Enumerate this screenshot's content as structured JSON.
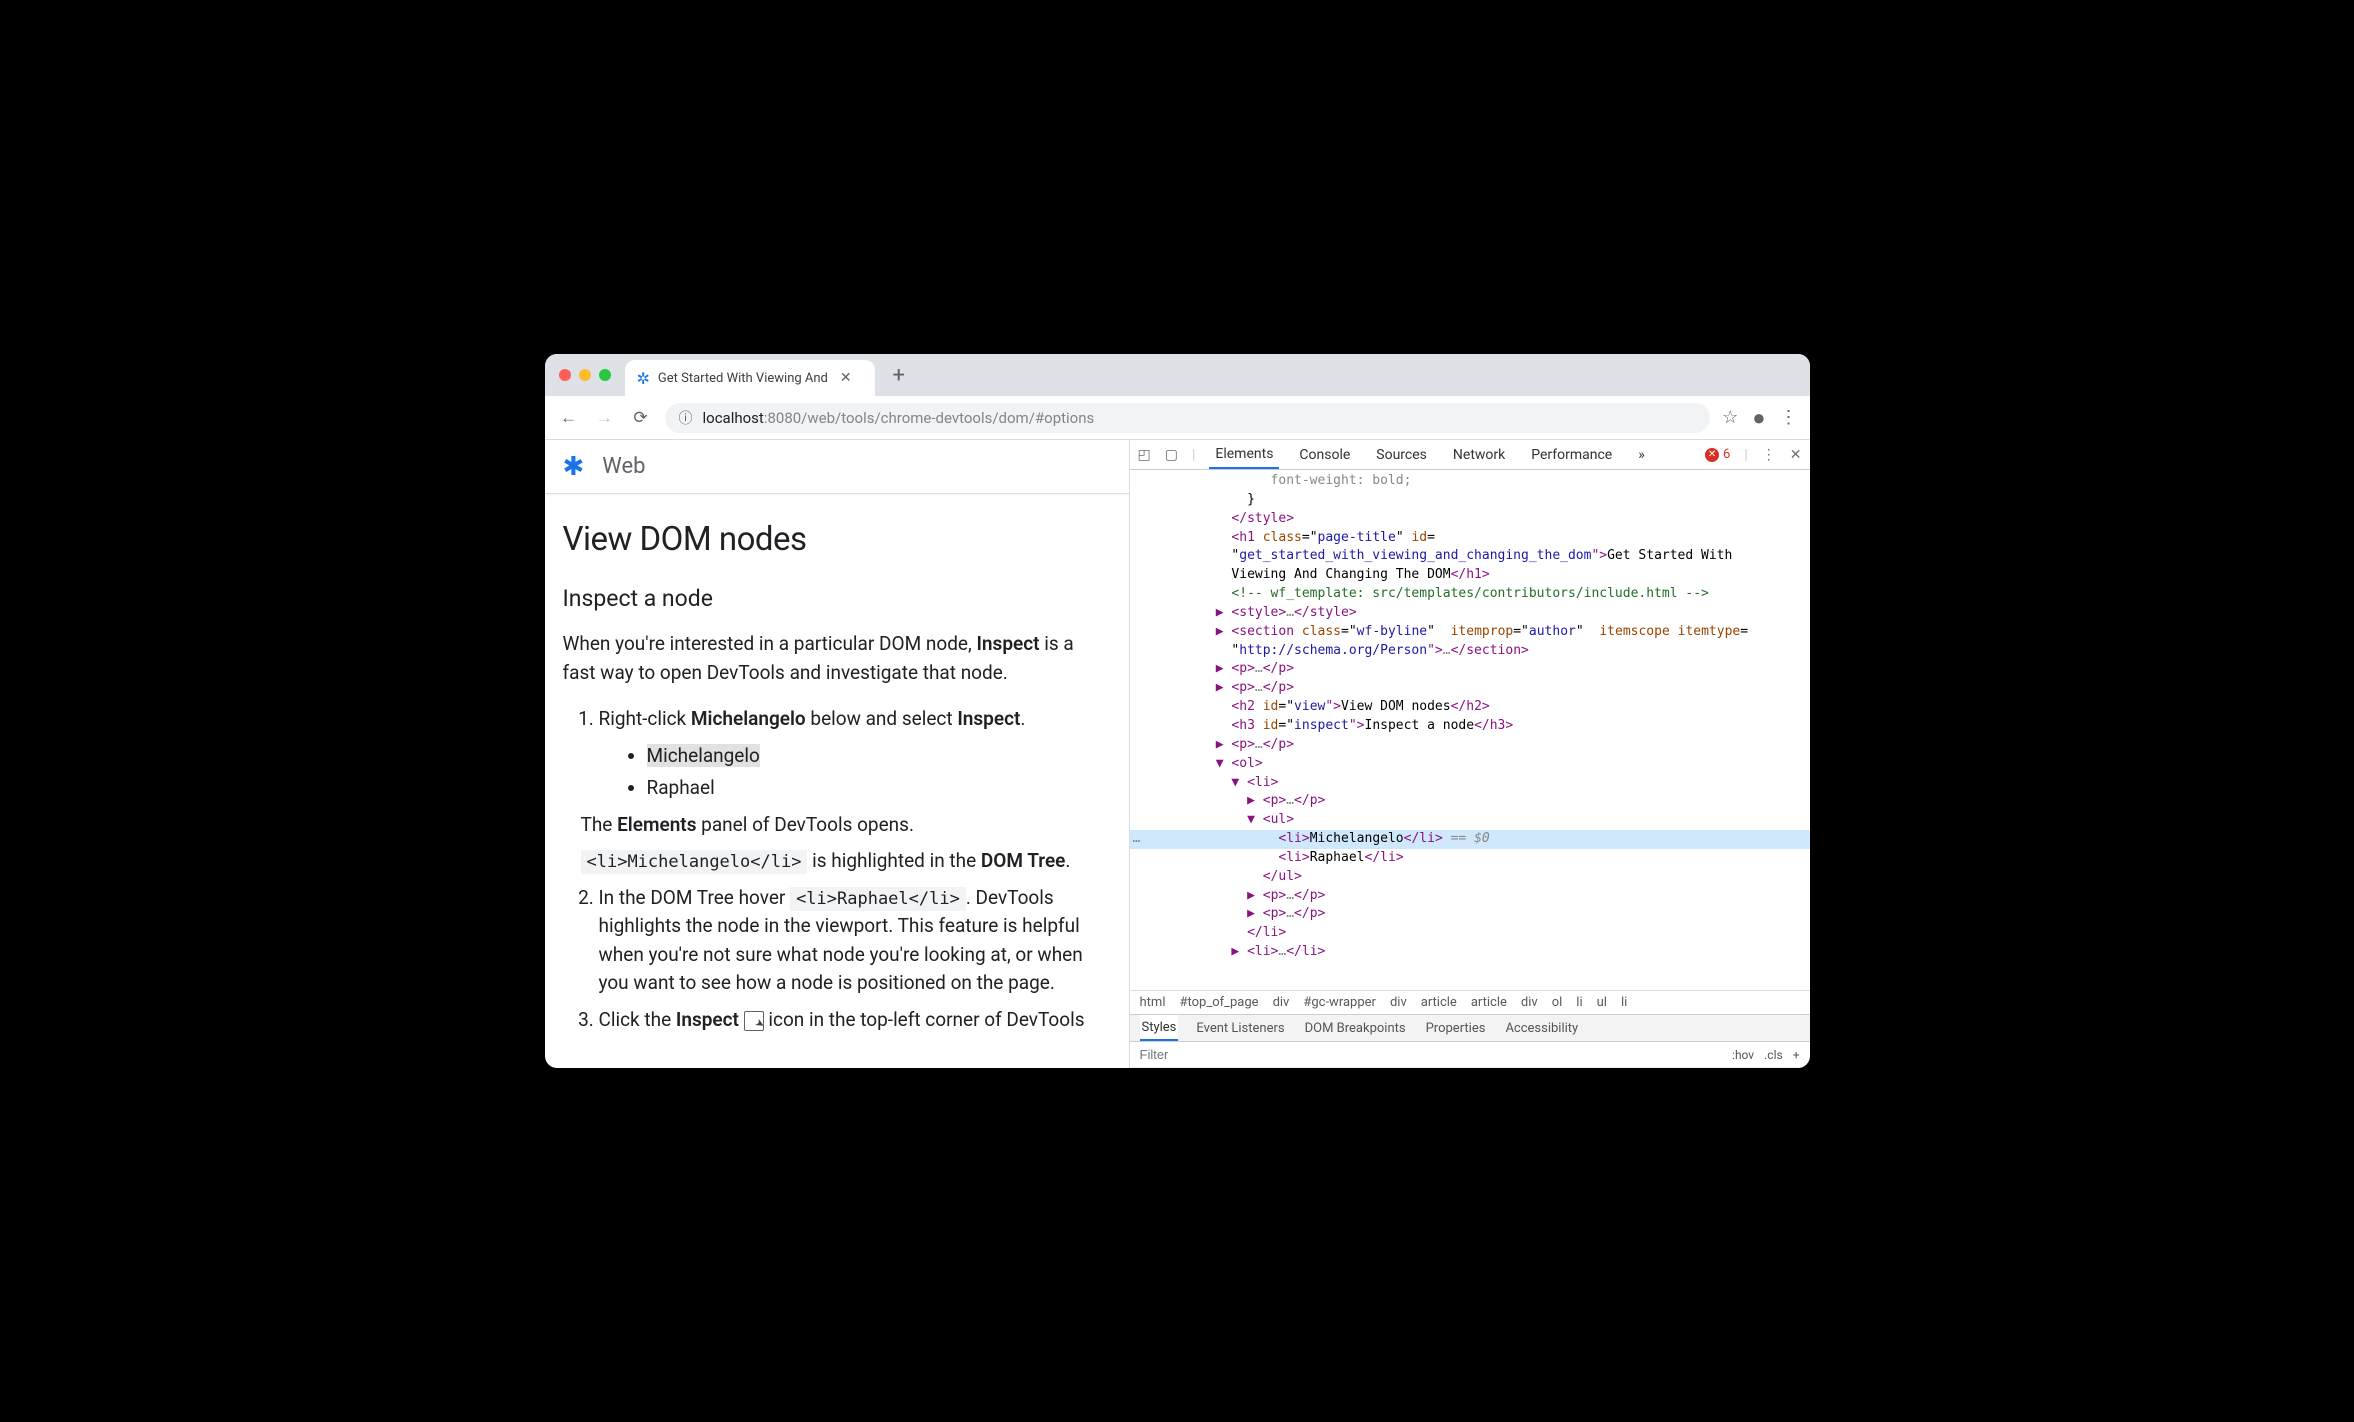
{
  "browser": {
    "tab_title": "Get Started With Viewing And",
    "url_host": "localhost",
    "url_port_path": ":8080/web/tools/chrome-devtools/dom/#options"
  },
  "page": {
    "site_title": "Web",
    "h1": "View DOM nodes",
    "h2": "Inspect a node",
    "intro_a": "When you're interested in a particular DOM node, ",
    "intro_b": "Inspect",
    "intro_c": " is a fast way to open DevTools and investigate that node.",
    "steps": {
      "s1_a": "Right-click ",
      "s1_b": "Michelangelo",
      "s1_c": " below and select ",
      "s1_d": "Inspect",
      "s1_e": ".",
      "bullets": [
        "Michelangelo",
        "Raphael"
      ],
      "s1_f_a": "The ",
      "s1_f_b": "Elements",
      "s1_f_c": " panel of DevTools opens.",
      "s1_g_code": "<li>Michelangelo</li>",
      "s1_g_mid": " is highlighted in the ",
      "s1_g_b": "DOM Tree",
      "s1_g_e": ".",
      "s2_a": "In the DOM Tree hover ",
      "s2_code": "<li>Raphael</li>",
      "s2_b": ". DevTools highlights the node in the viewport. This feature is helpful when you're not sure what node you're looking at, or when you want to see how a node is positioned on the page.",
      "s3_a": "Click the ",
      "s3_b": "Inspect",
      "s3_c": " icon in the top-left corner of DevTools"
    }
  },
  "devtools": {
    "tabs": [
      "Elements",
      "Console",
      "Sources",
      "Network",
      "Performance"
    ],
    "more": "»",
    "error_count": "6",
    "elements_code": {
      "l0": "                 font-weight: bold;",
      "l1": "              }",
      "l2a": "            </",
      "l2b": "style",
      "l2c": ">",
      "l3a": "            <",
      "l3b": "h1",
      "l3c": " class",
      "l3d": "=\"",
      "l3e": "page-title",
      "l3f": "\" ",
      "l3g": "id",
      "l3h": "=",
      "l4a": "            \"",
      "l4b": "get_started_with_viewing_and_changing_the_dom",
      "l4c": "\">",
      "l4d": "Get Started With",
      "l5a": "            Viewing And Changing The DOM",
      "l5b": "</",
      "l5c": "h1",
      "l5d": ">",
      "l6": "            <!-- wf_template: src/templates/contributors/include.html -->",
      "l7a": "          ▶ <",
      "l7b": "style",
      "l7c": ">",
      "l7d": "…",
      "l7e": "</",
      "l7f": "style",
      "l7g": ">",
      "l8a": "          ▶ <",
      "l8b": "section",
      "l8c": " class",
      "l8d": "=\"",
      "l8e": "wf-byline",
      "l8f": "\"  ",
      "l8g": "itemprop",
      "l8h": "=\"",
      "l8i": "author",
      "l8j": "\"  ",
      "l8k": "itemscope",
      "l8l": " itemtype",
      "l8m": "=",
      "l9a": "            \"",
      "l9b": "http://schema.org/Person",
      "l9c": "\">",
      "l9d": "…",
      "l9e": "</",
      "l9f": "section",
      "l9g": ">",
      "l10a": "          ▶ <",
      "l10b": "p",
      "l10c": ">",
      "l10d": "…",
      "l10e": "</",
      "l10f": "p",
      "l10g": ">",
      "l11a": "          ▶ <",
      "l11b": "p",
      "l11c": ">",
      "l11d": "…",
      "l11e": "</",
      "l11f": "p",
      "l11g": ">",
      "l12a": "            <",
      "l12b": "h2",
      "l12c": " id",
      "l12d": "=\"",
      "l12e": "view",
      "l12f": "\">",
      "l12g": "View DOM nodes",
      "l12h": "</",
      "l12i": "h2",
      "l12j": ">",
      "l13a": "            <",
      "l13b": "h3",
      "l13c": " id",
      "l13d": "=\"",
      "l13e": "inspect",
      "l13f": "\">",
      "l13g": "Inspect a node",
      "l13h": "</",
      "l13i": "h3",
      "l13j": ">",
      "l14a": "          ▶ <",
      "l14b": "p",
      "l14c": ">",
      "l14d": "…",
      "l14e": "</",
      "l14f": "p",
      "l14g": ">",
      "l15a": "          ▼ <",
      "l15b": "ol",
      "l15c": ">",
      "l16a": "            ▼ <",
      "l16b": "li",
      "l16c": ">",
      "l17a": "              ▶ <",
      "l17b": "p",
      "l17c": ">",
      "l17d": "…",
      "l17e": "</",
      "l17f": "p",
      "l17g": ">",
      "l18a": "              ▼ <",
      "l18b": "ul",
      "l18c": ">",
      "l19a": "                  <",
      "l19b": "li",
      "l19c": ">",
      "l19d": "Michelangelo",
      "l19e": "</",
      "l19f": "li",
      "l19g": ">",
      "l19h": " == $0",
      "l20a": "                  <",
      "l20b": "li",
      "l20c": ">",
      "l20d": "Raphael",
      "l20e": "</",
      "l20f": "li",
      "l20g": ">",
      "l21a": "                </",
      "l21b": "ul",
      "l21c": ">",
      "l22a": "              ▶ <",
      "l22b": "p",
      "l22c": ">",
      "l22d": "…",
      "l22e": "</",
      "l22f": "p",
      "l22g": ">",
      "l23a": "              ▶ <",
      "l23b": "p",
      "l23c": ">",
      "l23d": "…",
      "l23e": "</",
      "l23f": "p",
      "l23g": ">",
      "l24a": "              </",
      "l24b": "li",
      "l24c": ">",
      "l25a": "            ▶ <",
      "l25b": "li",
      "l25c": ">",
      "l25d": "…",
      "l25e": "</",
      "l25f": "li",
      "l25g": ">"
    },
    "breadcrumb": [
      "html",
      "#top_of_page",
      "div",
      "#gc-wrapper",
      "div",
      "article",
      "article",
      "div",
      "ol",
      "li",
      "ul",
      "li"
    ],
    "styles_tabs": [
      "Styles",
      "Event Listeners",
      "DOM Breakpoints",
      "Properties",
      "Accessibility"
    ],
    "filter_placeholder": "Filter",
    "hov": ":hov",
    "cls": ".cls"
  }
}
